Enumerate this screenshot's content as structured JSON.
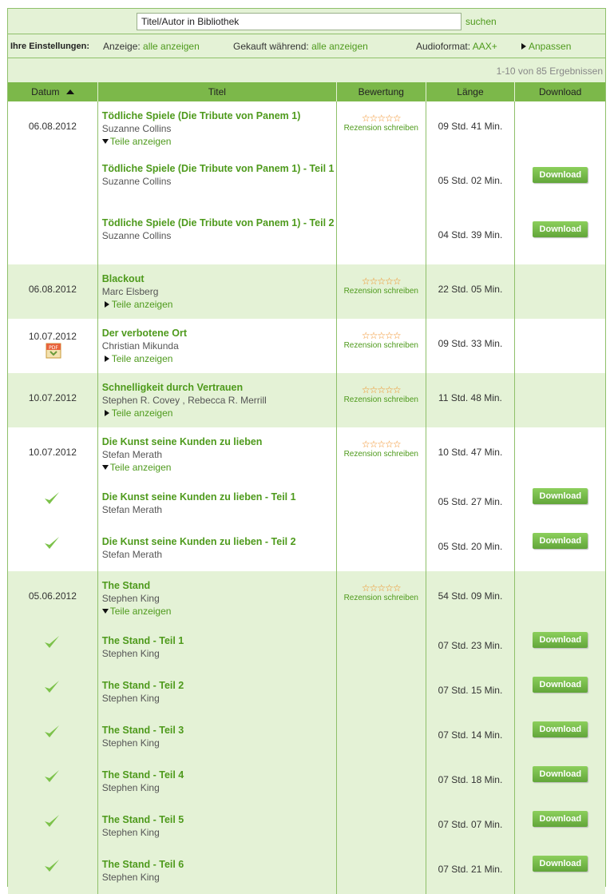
{
  "search": {
    "placeholder": "Titel/Autor in Bibliothek",
    "value": "Titel/Autor in Bibliothek",
    "button": "suchen"
  },
  "settings": {
    "label": "Ihre Einstellungen:",
    "display_label": "Anzeige:",
    "display_value": "alle anzeigen",
    "bought_label": "Gekauft während:",
    "bought_value": "alle anzeigen",
    "format_label": "Audioformat:",
    "format_value": "AAX+",
    "customize": "Anpassen"
  },
  "results": "1-10 von 85 Ergebnissen",
  "columns": {
    "date": "Datum",
    "title": "Titel",
    "rating": "Bewertung",
    "length": "Länge",
    "download": "Download"
  },
  "labels": {
    "show_parts": "Teile anzeigen",
    "review": "Rezension schreiben",
    "download": "Download",
    "stars": "☆☆☆☆☆"
  },
  "books": [
    {
      "date": "06.08.2012",
      "title": "Tödliche Spiele (Die Tribute von Panem 1)",
      "author": "Suzanne Collins",
      "length": "09 Std. 41 Min.",
      "parts": [
        {
          "title": "Tödliche Spiele (Die Tribute von Panem 1) - Teil 1",
          "author": "Suzanne Collins",
          "length": "05 Std. 02 Min."
        },
        {
          "title": "Tödliche Spiele (Die Tribute von Panem 1) - Teil 2",
          "author": "Suzanne Collins",
          "length": "04 Std. 39 Min."
        }
      ]
    },
    {
      "date": "06.08.2012",
      "title": "Blackout",
      "author": "Marc Elsberg",
      "length": "22 Std. 05 Min."
    },
    {
      "date": "10.07.2012",
      "title": "Der verbotene Ort",
      "author": "Christian Mikunda",
      "length": "09 Std. 33 Min."
    },
    {
      "date": "10.07.2012",
      "title": "Schnelligkeit durch Vertrauen",
      "author": "Stephen R. Covey , Rebecca R. Merrill",
      "length": "11 Std. 48 Min."
    },
    {
      "date": "10.07.2012",
      "title": "Die Kunst seine Kunden zu lieben",
      "author": "Stefan Merath",
      "length": "10 Std. 47 Min.",
      "parts": [
        {
          "title": "Die Kunst seine Kunden zu lieben - Teil 1",
          "author": "Stefan Merath",
          "length": "05 Std. 27 Min."
        },
        {
          "title": "Die Kunst seine Kunden zu lieben - Teil 2",
          "author": "Stefan Merath",
          "length": "05 Std. 20 Min."
        }
      ]
    },
    {
      "date": "05.06.2012",
      "title": "The Stand",
      "author": "Stephen King",
      "length": "54 Std. 09 Min.",
      "parts": [
        {
          "title": "The Stand - Teil 1",
          "author": "Stephen King",
          "length": "07 Std. 23 Min."
        },
        {
          "title": "The Stand - Teil 2",
          "author": "Stephen King",
          "length": "07 Std. 15 Min."
        },
        {
          "title": "The Stand - Teil 3",
          "author": "Stephen King",
          "length": "07 Std. 14 Min."
        },
        {
          "title": "The Stand - Teil 4",
          "author": "Stephen King",
          "length": "07 Std. 18 Min."
        },
        {
          "title": "The Stand - Teil 5",
          "author": "Stephen King",
          "length": "07 Std. 07 Min."
        },
        {
          "title": "The Stand - Teil 6",
          "author": "Stephen King",
          "length": "07 Std. 21 Min."
        }
      ]
    }
  ]
}
